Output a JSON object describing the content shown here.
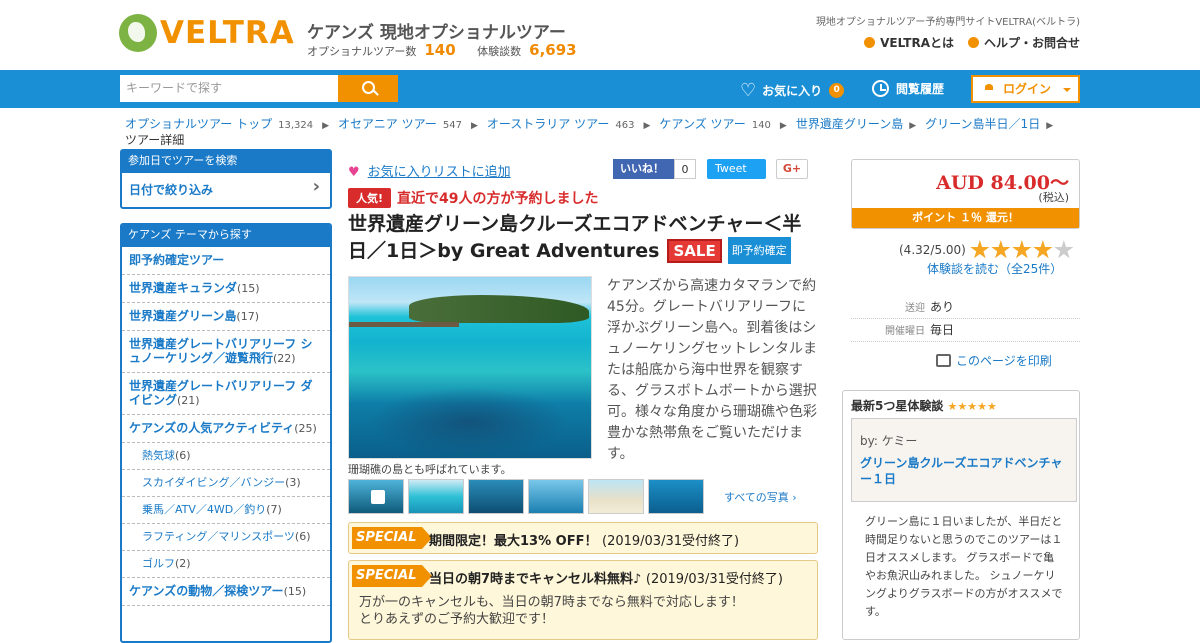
{
  "header": {
    "logo_text": "VELTRA",
    "site_title": "ケアンズ 現地オプショナルツアー",
    "tour_count_label": "オプショナルツアー数",
    "tour_count": "140",
    "review_count_label": "体験談数",
    "review_count": "6,693",
    "tagline": "現地オプショナルツアー予約専門サイトVELTRA(ベルトラ)",
    "about_link": "VELTRAとは",
    "help_link": "ヘルプ・お問合せ"
  },
  "nav": {
    "search_placeholder": "キーワードで探す",
    "favorites_label": "お気に入り",
    "favorites_count": "0",
    "history_label": "閲覧履歴",
    "login_label": "ログイン"
  },
  "breadcrumbs": [
    {
      "label": "オプショナルツアー トップ",
      "count": "13,324"
    },
    {
      "label": "オセアニア ツアー",
      "count": "547"
    },
    {
      "label": "オーストラリア ツアー",
      "count": "463"
    },
    {
      "label": "ケアンズ ツアー",
      "count": "140"
    },
    {
      "label": "世界遺産グリーン島",
      "count": ""
    },
    {
      "label": "グリーン島半日／1日",
      "count": ""
    }
  ],
  "breadcrumb_current": "ツアー詳細",
  "sidebar": {
    "date_search_header": "参加日でツアーを検索",
    "date_filter_label": "日付で絞り込み",
    "theme_header": "ケアンズ テーマから探す",
    "items": [
      {
        "label": "即予約確定ツアー",
        "count": ""
      },
      {
        "label": "世界遺産キュランダ",
        "count": "(15)"
      },
      {
        "label": "世界遺産グリーン島",
        "count": "(17)"
      },
      {
        "label": "世界遺産グレートバリアリーフ シュノーケリング／遊覧飛行",
        "count": "(22)"
      },
      {
        "label": "世界遺産グレートバリアリーフ ダイビング",
        "count": "(21)"
      },
      {
        "label": "ケアンズの人気アクティビティ",
        "count": "(25)"
      },
      {
        "label": "熱気球",
        "count": "(6)"
      },
      {
        "label": "スカイダイビング／バンジー",
        "count": "(3)"
      },
      {
        "label": "乗馬／ATV／4WD／釣り",
        "count": "(7)"
      },
      {
        "label": "ラフティング／マリンスポーツ",
        "count": "(6)"
      },
      {
        "label": "ゴルフ",
        "count": "(2)"
      },
      {
        "label": "ケアンズの動物／探検ツアー",
        "count": "(15)"
      }
    ]
  },
  "tour": {
    "fav_link": "お気に入りリストに追加",
    "like_label": "いいね！",
    "like_count": "0",
    "tweet_label": "Tweet",
    "gplus_label": "G+",
    "popular_tag": "人気!",
    "popular_text": "直近で49人の方が予約しました",
    "title": "世界遺産グリーン島クルーズエコアドベンチャー＜半日／1日＞by Great Adventures",
    "sale_badge": "SALE",
    "instant_badge": "即予約確定",
    "photo_caption": "珊瑚礁の島とも呼ばれています。",
    "description": "ケアンズから高速カタマランで約45分。グレートバリアリーフに浮かぶグリーン島へ。到着後はシュノーケリングセットレンタルまたは船底から海中世界を観察する、グラスボトムボートから選択可。様々な角度から珊瑚礁や色彩豊かな熱帯魚をご覧いただけます。",
    "all_photos": "すべての写真 ›"
  },
  "specials": [
    {
      "label": "SPECIAL",
      "text": "期間限定！最大13% OFF！",
      "date": "(2019/03/31受付終了)",
      "note1": "",
      "note2": ""
    },
    {
      "label": "SPECIAL",
      "text": "当日の朝7時までキャンセル料無料♪",
      "date": "(2019/03/31受付終了)",
      "note1": "万が一のキャンセルも、当日の朝7時までなら無料で対応します！",
      "note2": "とりあえずのご予約大歓迎です！"
    }
  ],
  "pricing": {
    "price": "AUD 84.00～",
    "tax": "(税込)",
    "point": "ポイント １％ 還元！",
    "rating": "(4.32/5.00)",
    "stars": 4,
    "review_link": "体験談を読む（全25件）",
    "pickup_key": "送迎",
    "pickup_val": "あり",
    "days_key": "開催曜日",
    "days_val": "毎日",
    "print_link": "このページを印刷"
  },
  "review": {
    "header": "最新5つ星体験談",
    "header_stars": "★★★★★",
    "by": "by: ケミー",
    "title": "グリーン島クルーズエコアドベンチャー１日",
    "body": "グリーン島に１日いましたが、半日だと時間足りないと思うのでこのツアーは１日オススメします。 グラスボードで亀やお魚沢山みれました。 シュノーケリングよりグラスボードの方がオススメです。"
  }
}
